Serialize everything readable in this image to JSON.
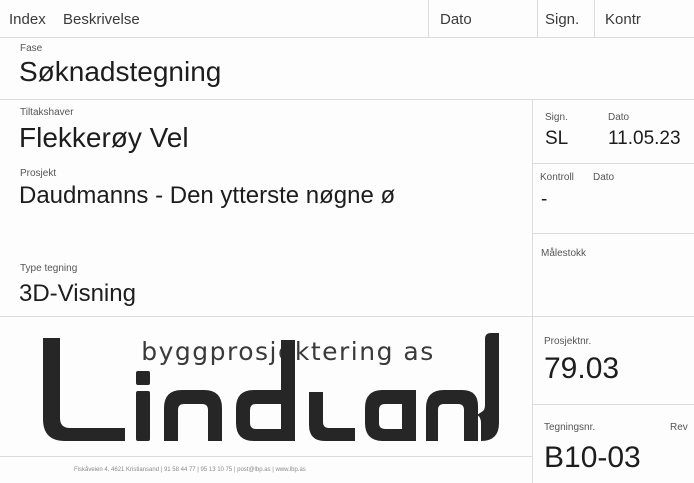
{
  "header": {
    "index": "Index",
    "beskrivelse": "Beskrivelse",
    "dato": "Dato",
    "sign": "Sign.",
    "kontr": "Kontr"
  },
  "fase": {
    "label": "Fase",
    "value": "Søknadstegning"
  },
  "tiltakshaver": {
    "label": "Tiltakshaver",
    "value": "Flekkerøy Vel"
  },
  "prosjekt": {
    "label": "Prosjekt",
    "value": "Daudmanns - Den ytterste nøgne ø"
  },
  "type_tegning": {
    "label": "Type tegning",
    "value": "3D-Visning"
  },
  "sign_block": {
    "sign_label": "Sign.",
    "sign_value": "SL",
    "dato_label": "Dato",
    "dato_value": "11.05.23"
  },
  "kontroll_block": {
    "kontroll_label": "Kontroll",
    "kontroll_value": "-",
    "dato_label": "Dato"
  },
  "malestokk": {
    "label": "Målestokk"
  },
  "prosjektnr": {
    "label": "Prosjektnr.",
    "value": "79.03"
  },
  "tegningsnr": {
    "label": "Tegningsnr.",
    "value": "B10-03",
    "rev_label": "Rev"
  },
  "logo": {
    "tagline": "byggprosjektering as",
    "wordmark": "LindLand"
  },
  "footer": {
    "text": "Fiskåveien 4, 4621 Kristiansand | 91 58 44 77 | 95 13 10 75 | post@lbp.as | www.lbp.as"
  }
}
